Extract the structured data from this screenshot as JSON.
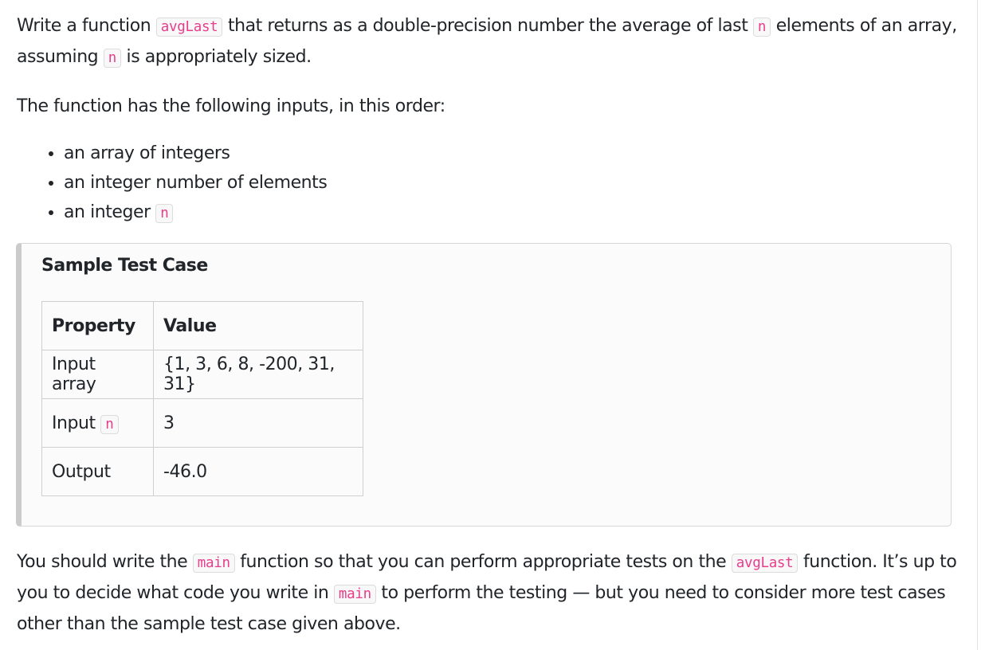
{
  "intro": {
    "line_a": "Write a function ",
    "func_name": "avgLast",
    "line_b": " that returns as a double-precision number the average of last ",
    "n_code": "n",
    "line_c": " elements of an array, assuming ",
    "line_d": " is appropriately sized."
  },
  "inputs_heading": "The function has the following inputs, in this order:",
  "inputs": [
    "an array of integers",
    "an integer number of elements",
    "an integer "
  ],
  "sample": {
    "title": "Sample Test Case",
    "headers": [
      "Property",
      "Value"
    ],
    "rows": [
      {
        "property": "Input array",
        "value": "{1, 3, 6, 8, -200, 31, 31}"
      },
      {
        "property": "Input ",
        "property_code": "n",
        "value": "3"
      },
      {
        "property": "Output",
        "value": "-46.0"
      }
    ]
  },
  "closing": {
    "a": "You should write the ",
    "main_code": "main",
    "b": " function so that you can perform appropriate tests on the ",
    "func_code": "avgLast",
    "c": " function. It’s up to you to decide what code you write in ",
    "d": " to perform the testing — but you need to consider more test cases other than the sample test case given above."
  }
}
